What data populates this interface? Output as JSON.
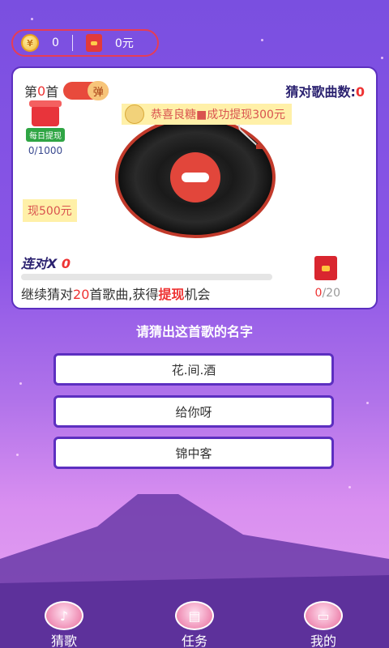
{
  "wallet": {
    "coins": "0",
    "cash": "0元"
  },
  "game": {
    "round_prefix": "第",
    "round_value": "0",
    "round_suffix": "首",
    "popup_toggle": "弹",
    "correct_label": "猜对歌曲数:",
    "correct_value": "0",
    "daily_tag": "每日提现",
    "daily_progress": "0/1000",
    "notice": "恭喜良糖■成功提现300元",
    "cash_tip": "现500元",
    "combo_label": "连对X",
    "combo_value": "0",
    "hint_pre": "继续猜对",
    "hint_num": "20",
    "hint_mid": "首歌曲,获得",
    "hint_key": "提现",
    "hint_post": "机会",
    "envelope_done": "0",
    "envelope_total": "/20"
  },
  "question": "请猜出这首歌的名字",
  "options": [
    "花.间.酒",
    "给你呀",
    "锦中客"
  ],
  "nav": {
    "items": [
      {
        "label": "猜歌"
      },
      {
        "label": "任务"
      },
      {
        "label": "我的"
      }
    ]
  },
  "icons": {
    "coin": "coin-icon",
    "redpacket": "red-packet-icon",
    "gift": "gift-icon",
    "record": "vinyl-record-icon",
    "music": "music-note-icon",
    "task": "task-card-icon",
    "wallet": "wallet-icon"
  },
  "colors": {
    "accent": "#e84a3c",
    "primary": "#5c2fc0"
  }
}
